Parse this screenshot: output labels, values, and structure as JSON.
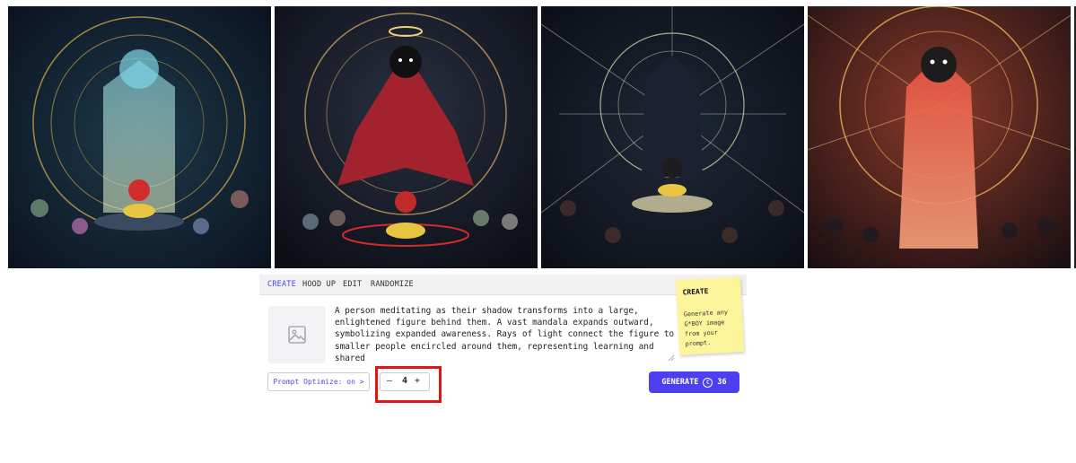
{
  "gallery": {
    "images": [
      {
        "name": "generated-image-1"
      },
      {
        "name": "generated-image-2"
      },
      {
        "name": "generated-image-3"
      },
      {
        "name": "generated-image-4"
      }
    ]
  },
  "tabs": [
    {
      "label": "CREATE",
      "active": true
    },
    {
      "label": "HOOD UP",
      "active": false
    },
    {
      "label": "EDIT",
      "active": false
    },
    {
      "label": "RANDOMIZE",
      "active": false
    }
  ],
  "prompt": {
    "icon": "image-placeholder-icon",
    "value": "A person meditating as their shadow transforms into a large,\nenlightened figure behind them. A vast mandala expands outward,\nsymbolizing expanded awareness. Rays of light connect the figure to\nsmaller people encircled around them, representing learning and shared\nwisdom. Mystical, elegant, richly symbolic."
  },
  "note": {
    "title": "CREATE",
    "text": "Generate any G*BOY image from your prompt."
  },
  "controls": {
    "optimize_label": "Prompt Optimize: on >",
    "stepper_minus": "–",
    "stepper_value": "4",
    "stepper_plus": "+",
    "generate_label": "GENERATE",
    "credits": "36",
    "credit_icon": "coin-icon"
  },
  "colors": {
    "accent": "#4f46e5",
    "generate_bg": "#4b3ff0",
    "highlight": "#e01616",
    "note_bg": "#fdf59b"
  }
}
